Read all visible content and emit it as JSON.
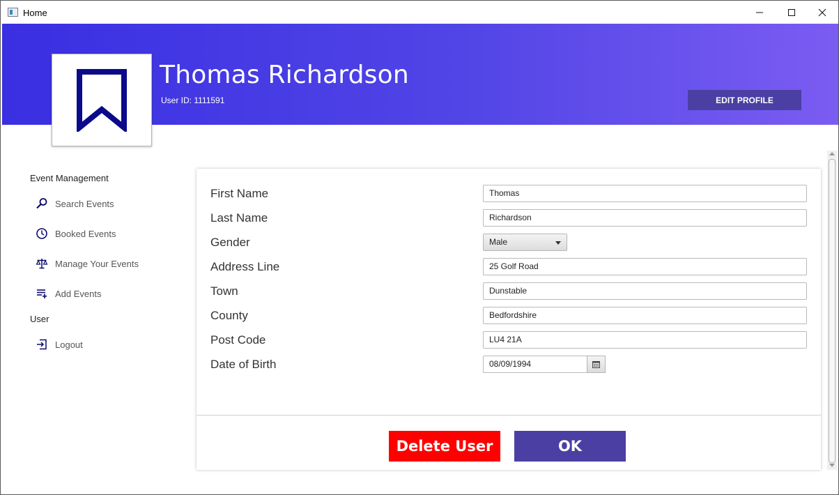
{
  "window": {
    "title": "Home"
  },
  "header": {
    "name": "Thomas Richardson",
    "user_id": "User ID: 1111591",
    "edit_profile_label": "EDIT PROFILE"
  },
  "sidebar": {
    "event_heading": "Event Management",
    "items": [
      {
        "label": "Search Events",
        "icon": "search-icon"
      },
      {
        "label": "Booked Events",
        "icon": "clock-icon"
      },
      {
        "label": "Manage Your Events",
        "icon": "scales-icon"
      },
      {
        "label": "Add Events",
        "icon": "add-list-icon"
      }
    ],
    "user_heading": "User",
    "logout_label": "Logout"
  },
  "form": {
    "fields": [
      {
        "label": "First Name",
        "value": "Thomas"
      },
      {
        "label": "Last Name",
        "value": "Richardson"
      },
      {
        "label": "Gender",
        "value": "Male"
      },
      {
        "label": "Address Line",
        "value": "25 Golf Road"
      },
      {
        "label": "Town",
        "value": "Dunstable"
      },
      {
        "label": "County",
        "value": "Bedfordshire"
      },
      {
        "label": "Post Code",
        "value": "LU4 21A"
      },
      {
        "label": "Date of Birth",
        "value": "08/09/1994"
      }
    ]
  },
  "actions": {
    "delete_label": "Delete User",
    "ok_label": "OK"
  },
  "colors": {
    "header_start": "#3a2fe2",
    "header_end": "#7b5cf2",
    "primary_button": "#4b3fa3",
    "delete_button": "#ff0000",
    "bookmark_icon": "#0a0a8a"
  }
}
